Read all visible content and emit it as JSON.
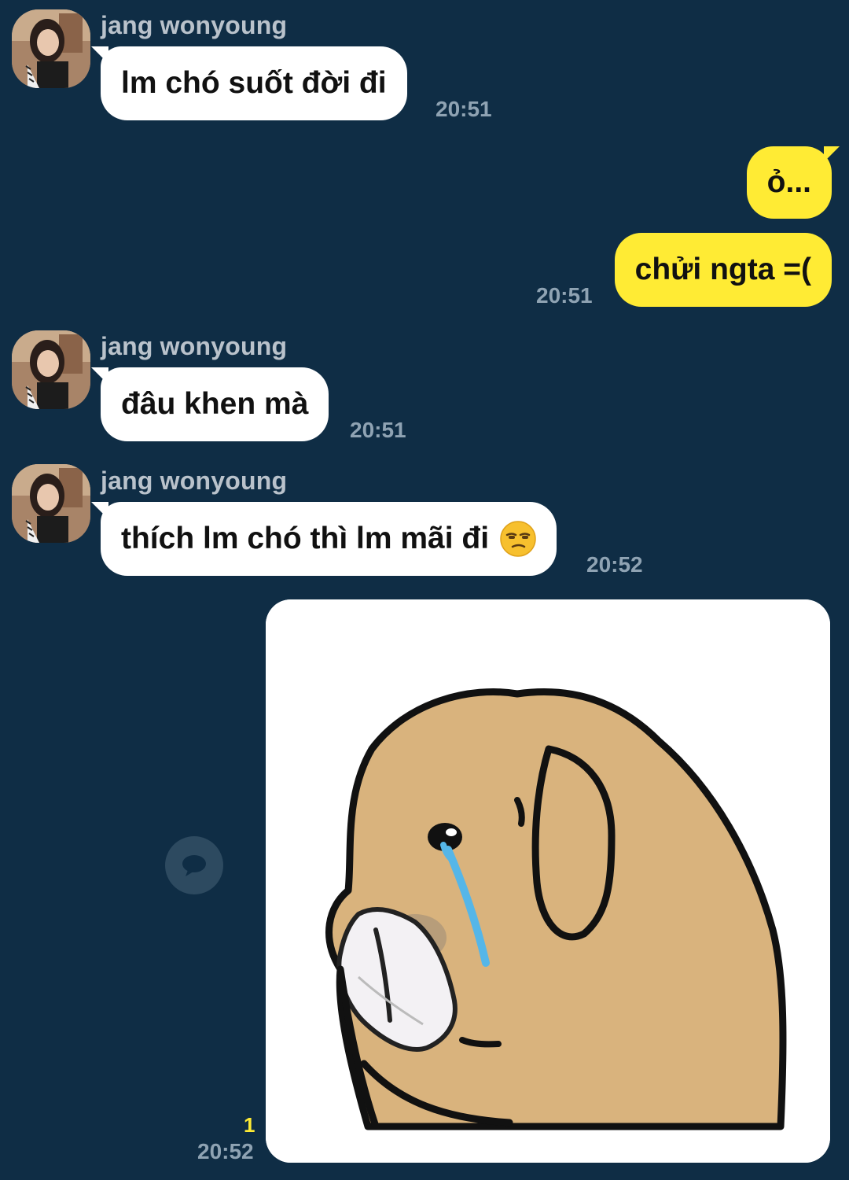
{
  "messages": [
    {
      "direction": "in",
      "sender": "jang wonyoung",
      "text": "lm chó suốt đời đi",
      "time": "20:51"
    },
    {
      "direction": "out",
      "text": "ỏ...",
      "time": ""
    },
    {
      "direction": "out",
      "text": "chửi ngta =(",
      "time": "20:51"
    },
    {
      "direction": "in",
      "sender": "jang wonyoung",
      "text": "đâu khen mà",
      "time": "20:51"
    },
    {
      "direction": "in",
      "sender": "jang wonyoung",
      "text": "thích lm chó thì lm mãi đi",
      "emoji": "unamused-face",
      "time": "20:52"
    },
    {
      "direction": "out",
      "type": "sticker",
      "image": "crying-dog-with-tissue",
      "unread_count": "1",
      "time": "20:52"
    }
  ],
  "icons": {
    "share": "speech-bubble-icon"
  },
  "colors": {
    "background": "#0f2d45",
    "incoming_bubble": "#ffffff",
    "outgoing_bubble": "#ffeb34",
    "sender_name": "#b9c2cb",
    "timestamp": "#8fa3b3",
    "unread": "#ffeb34"
  }
}
